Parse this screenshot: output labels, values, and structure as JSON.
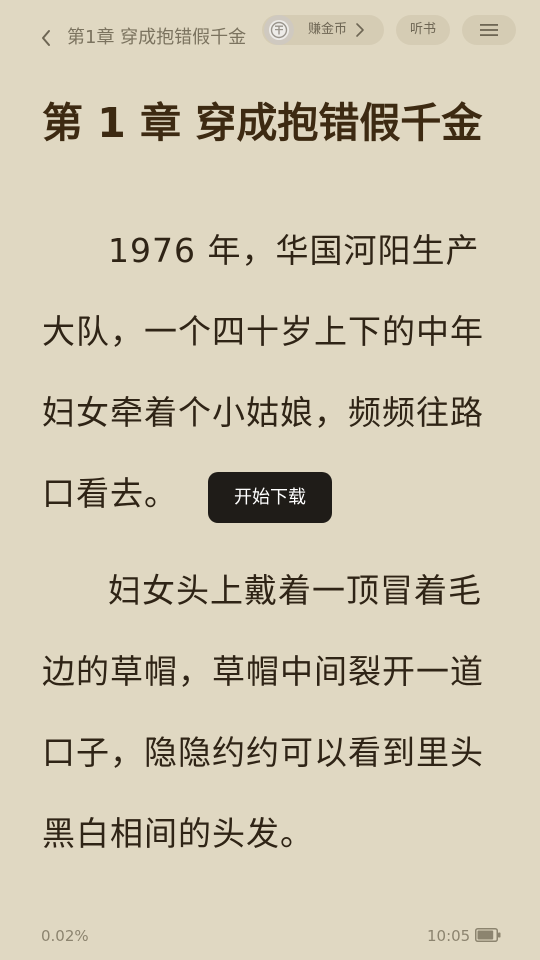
{
  "header": {
    "chapter_crumb": "第1章 穿成抱错假千金",
    "coin_label": "赚金币",
    "coin_icon": "coin-icon",
    "listen_label": "听书",
    "menu_icon": "hamburger-menu-icon",
    "back_icon": "chevron-left-icon"
  },
  "chapter": {
    "title": "第 1 章 穿成抱错假千金",
    "paragraphs": [
      "1976 年，华国河阳生产大队，一个四十岁上下的中年妇女牵着个小姑娘，频频往路口看去。",
      "妇女头上戴着一顶冒着毛边的草帽，草帽中间裂开一道口子，隐隐约约可以看到里头黑白相间的头发。"
    ]
  },
  "toast": {
    "text": "开始下载"
  },
  "footer": {
    "progress": "0.02%",
    "time": "10:05",
    "battery_icon": "battery-icon",
    "battery_level": 0.85
  },
  "colors": {
    "background": "#e0d8c2",
    "title": "#3d2a12",
    "body_text": "#2f2416",
    "pill": "#d5ccb4",
    "toast_bg": "#1f1c18"
  }
}
